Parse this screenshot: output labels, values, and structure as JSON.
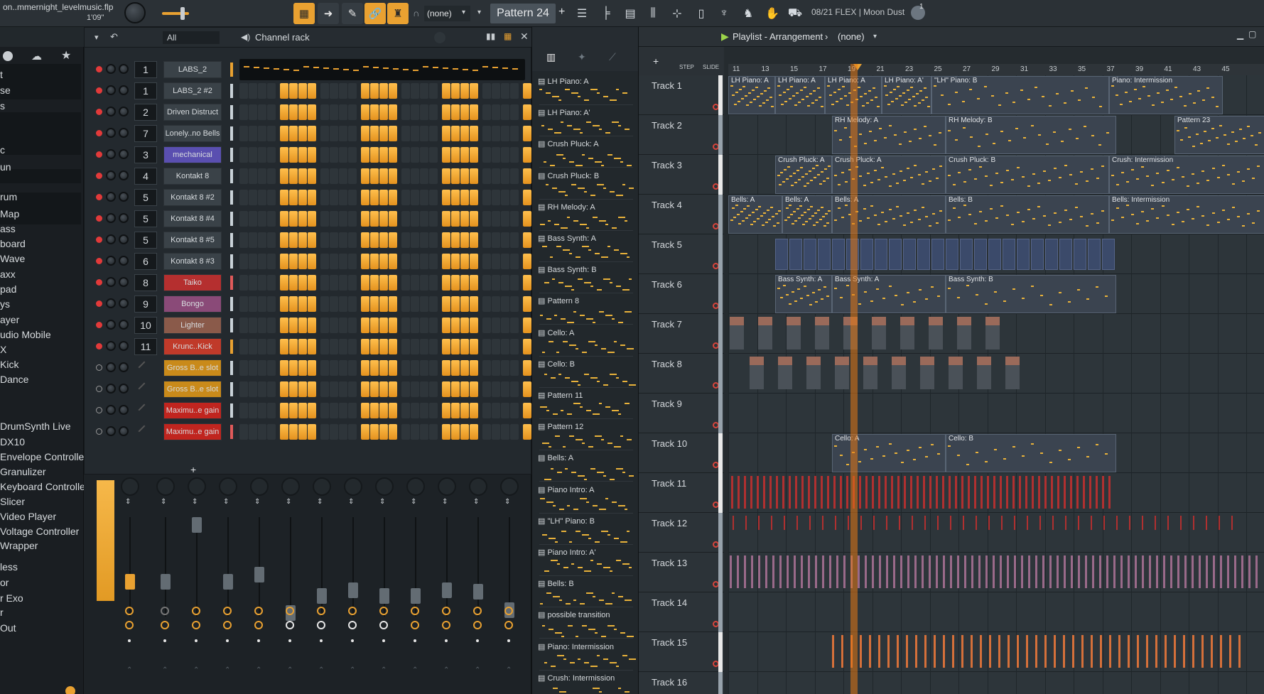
{
  "app": {
    "project_file": "on..mmernight_levelmusic.flp",
    "time": "1'09\""
  },
  "toolbar": {
    "pattern_label": "Pattern 24",
    "pattern_add": "+",
    "none_select": "(none)",
    "hint_text": "08/21  FLEX | Moon Dust",
    "notice_count": "1"
  },
  "browser": {
    "items": [
      "t",
      "se",
      "s",
      "c",
      "un",
      "rum",
      "Map",
      "ass",
      "board",
      "Wave",
      "axx",
      "pad",
      "ys",
      "ayer",
      "udio Mobile",
      "X",
      "Kick",
      "Dance",
      "DrumSynth Live",
      "DX10",
      "Envelope Controller",
      "Granulizer",
      "Keyboard Controller",
      "Slicer",
      "Video Player",
      "Voltage Controller",
      "Wrapper",
      "less",
      "or",
      "r Exo",
      "r",
      "Out"
    ]
  },
  "channel_rack": {
    "title": "Channel rack",
    "filter": "All",
    "add_label": "+",
    "channels": [
      {
        "num": "1",
        "name": "LABS_2",
        "color": "#3a4248"
      },
      {
        "num": "1",
        "name": "LABS_2 #2",
        "color": "#3a4248"
      },
      {
        "num": "2",
        "name": "Driven Distruct",
        "color": "#3a4248"
      },
      {
        "num": "7",
        "name": "Lonely..no Bells",
        "color": "#3a4248"
      },
      {
        "num": "3",
        "name": "mechanical",
        "color": "#5a4fb0"
      },
      {
        "num": "4",
        "name": "Kontakt 8",
        "color": "#3a4248"
      },
      {
        "num": "5",
        "name": "Kontakt 8 #2",
        "color": "#3a4248"
      },
      {
        "num": "5",
        "name": "Kontakt 8 #4",
        "color": "#3a4248"
      },
      {
        "num": "5",
        "name": "Kontakt 8 #5",
        "color": "#3a4248"
      },
      {
        "num": "6",
        "name": "Kontakt 8 #3",
        "color": "#3a4248"
      },
      {
        "num": "8",
        "name": "Taiko",
        "color": "#b52f2f"
      },
      {
        "num": "9",
        "name": "Bongo",
        "color": "#8a4a78"
      },
      {
        "num": "10",
        "name": "Lighter",
        "color": "#8a5a4a"
      },
      {
        "num": "11",
        "name": "Krunc..Kick",
        "color": "#c03a2a"
      },
      {
        "num": "",
        "name": "Gross B..e slot",
        "color": "#c98a1a"
      },
      {
        "num": "",
        "name": "Gross B..e slot",
        "color": "#c98a1a"
      },
      {
        "num": "",
        "name": "Maximu..e gain",
        "color": "#c0251f"
      },
      {
        "num": "",
        "name": "Maximu..e gain",
        "color": "#c0251f"
      }
    ]
  },
  "picker": {
    "items": [
      "LH Piano: A",
      "LH Piano: A'",
      "Crush Pluck: A",
      "Crush Pluck: B",
      "RH Melody: A",
      "Bass Synth: A",
      "Bass Synth: B",
      "Pattern 8",
      "Cello: A",
      "Cello: B",
      "Pattern 11",
      "Pattern 12",
      "Bells: A",
      "Piano Intro: A",
      "\"LH\" Piano: B",
      "Piano Intro: A'",
      "Bells: B",
      "possible transition",
      "Piano: Intermission",
      "Crush: Intermission"
    ]
  },
  "playlist": {
    "title": "Playlist - Arrangement",
    "selection": "(none)",
    "step_label": "STEP",
    "slide_label": "SLIDE",
    "ruler": [
      "11",
      "13",
      "15",
      "17",
      "19",
      "21",
      "23",
      "25",
      "27",
      "29",
      "31",
      "33",
      "35",
      "37",
      "39",
      "41",
      "43",
      "45"
    ],
    "tracks": [
      "Track 1",
      "Track 2",
      "Track 3",
      "Track 4",
      "Track 5",
      "Track 6",
      "Track 7",
      "Track 8",
      "Track 9",
      "Track 10",
      "Track 11",
      "Track 12",
      "Track 13",
      "Track 14",
      "Track 15",
      "Track 16"
    ],
    "clip_labels": {
      "t1": [
        "LH Piano: A",
        "LH Piano: A",
        "LH Piano: A",
        "LH Piano: A'",
        "\"LH\" Piano: B",
        "Piano: Intermission"
      ],
      "t2": [
        "RH Melody: A",
        "RH Melody: B",
        "Pattern 23"
      ],
      "t3": [
        "Crush Pluck: A",
        "Crush Pluck: A",
        "Crush Pluck: B",
        "Crush: Intermission"
      ],
      "t4": [
        "Bells: A",
        "Bells: A",
        "Bells: A",
        "Bells: B",
        "Bells: Intermission"
      ],
      "t6": [
        "Bass Synth: A",
        "Bass Synth: A",
        "Bass Synth: B"
      ],
      "t10": [
        "Cello: A",
        "Cello: B"
      ]
    }
  },
  "colors": {
    "accent": "#f0a432",
    "playhead": "#e87a14",
    "selected_bg": "#e9a131"
  }
}
